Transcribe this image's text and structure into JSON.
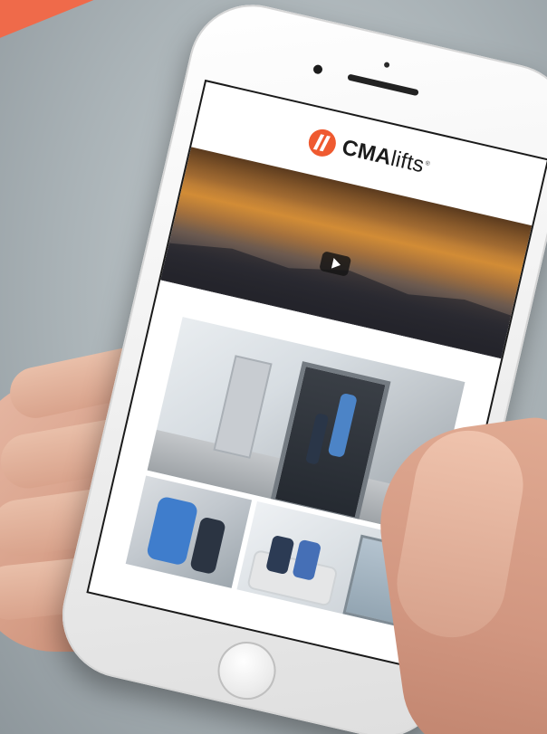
{
  "brand": {
    "name_bold": "CMA",
    "name_light": "lifts",
    "trademark": "®"
  },
  "video": {
    "play_icon": "play-icon"
  },
  "colors": {
    "accent": "#ef5a30",
    "corner_accent": "#ef6a4a",
    "background": "#b8c0c4"
  }
}
